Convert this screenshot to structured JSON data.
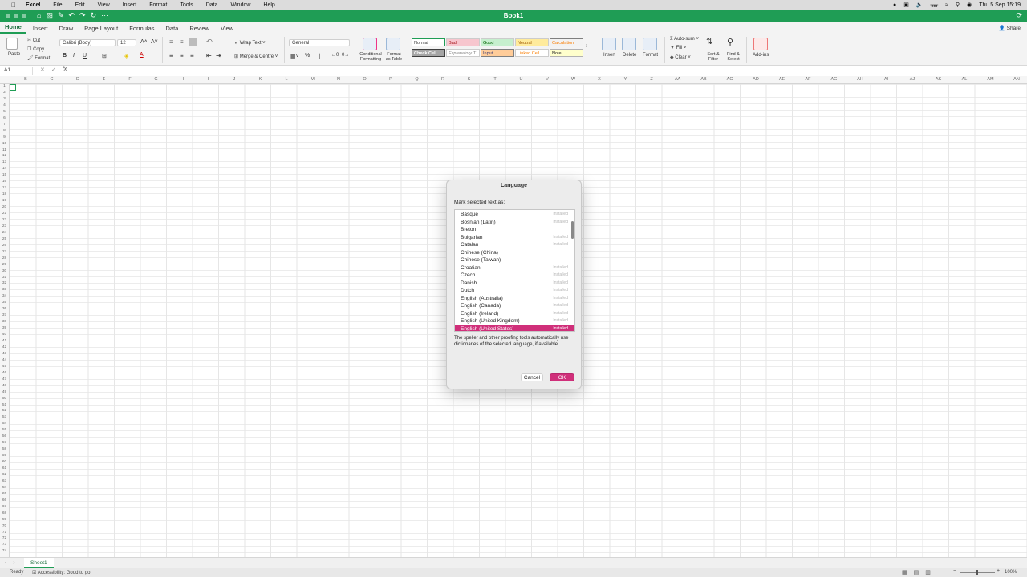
{
  "menubar": {
    "app": "Excel",
    "items": [
      "File",
      "Edit",
      "View",
      "Insert",
      "Format",
      "Tools",
      "Data",
      "Window",
      "Help"
    ],
    "clock": "Thu 5 Sep  15:19"
  },
  "window": {
    "title": "Book1"
  },
  "tabs": [
    "Home",
    "Insert",
    "Draw",
    "Page Layout",
    "Formulas",
    "Data",
    "Review",
    "View"
  ],
  "share_label": "Share",
  "ribbon": {
    "paste": "Paste",
    "cut": "Cut",
    "copy": "Copy",
    "format": "Format",
    "font_name": "Calibri (Body)",
    "font_size": "12",
    "wrap_text": "Wrap Text",
    "merge_centre": "Merge & Centre",
    "number_format": "General",
    "conditional_formatting": "Conditional Formatting",
    "format_as_table": "Format as Table",
    "styles": {
      "normal": "Normal",
      "bad": "Bad",
      "good": "Good",
      "neutral": "Neutral",
      "calculation": "Calculation",
      "check_cell": "Check Cell",
      "explanatory": "Explanatory T...",
      "input": "Input",
      "linked_cell": "Linked Cell",
      "note": "Note"
    },
    "insert": "Insert",
    "delete": "Delete",
    "format_cells": "Format",
    "autosum": "Auto-sum",
    "fill": "Fill",
    "clear": "Clear",
    "sort_filter": "Sort & Filter",
    "find_select": "Find & Select",
    "add_ins": "Add-ins"
  },
  "formula_bar": {
    "name_box": "A1",
    "fx": "fx"
  },
  "columns": [
    "B",
    "C",
    "D",
    "E",
    "F",
    "G",
    "H",
    "I",
    "J",
    "K",
    "L",
    "M",
    "N",
    "O",
    "P",
    "Q",
    "R",
    "S",
    "T",
    "U",
    "V",
    "W",
    "X",
    "Y",
    "Z",
    "AA",
    "AB",
    "AC",
    "AD",
    "AE",
    "AF",
    "AG",
    "AH",
    "AI",
    "AJ",
    "AK",
    "AL",
    "AM",
    "AN"
  ],
  "sheet": {
    "name": "Sheet1"
  },
  "status": {
    "ready": "Ready",
    "accessibility": "Accessibility: Good to go",
    "zoom": "100%",
    "zoom_fraction": 0.5
  },
  "dialog": {
    "title": "Language",
    "label": "Mark selected text as:",
    "languages": [
      {
        "name": "Basque",
        "status": "Installed"
      },
      {
        "name": "Bosnian (Latin)",
        "status": "Installed"
      },
      {
        "name": "Breton",
        "status": ""
      },
      {
        "name": "Bulgarian",
        "status": "Installed"
      },
      {
        "name": "Catalan",
        "status": "Installed"
      },
      {
        "name": "Chinese (China)",
        "status": ""
      },
      {
        "name": "Chinese (Taiwan)",
        "status": ""
      },
      {
        "name": "Croatian",
        "status": "Installed"
      },
      {
        "name": "Czech",
        "status": "Installed"
      },
      {
        "name": "Danish",
        "status": "Installed"
      },
      {
        "name": "Dutch",
        "status": "Installed"
      },
      {
        "name": "English (Australia)",
        "status": "Installed"
      },
      {
        "name": "English (Canada)",
        "status": "Installed"
      },
      {
        "name": "English (Ireland)",
        "status": "Installed"
      },
      {
        "name": "English (United Kingdom)",
        "status": "Installed"
      },
      {
        "name": "English (United States)",
        "status": "Installed"
      }
    ],
    "selected_index": 15,
    "note": "The speller and other proofing tools automatically use dictionaries of the selected language, if available.",
    "cancel": "Cancel",
    "ok": "OK"
  },
  "colors": {
    "accent_green": "#1f9d55",
    "selection_pink": "#d02f7a"
  }
}
